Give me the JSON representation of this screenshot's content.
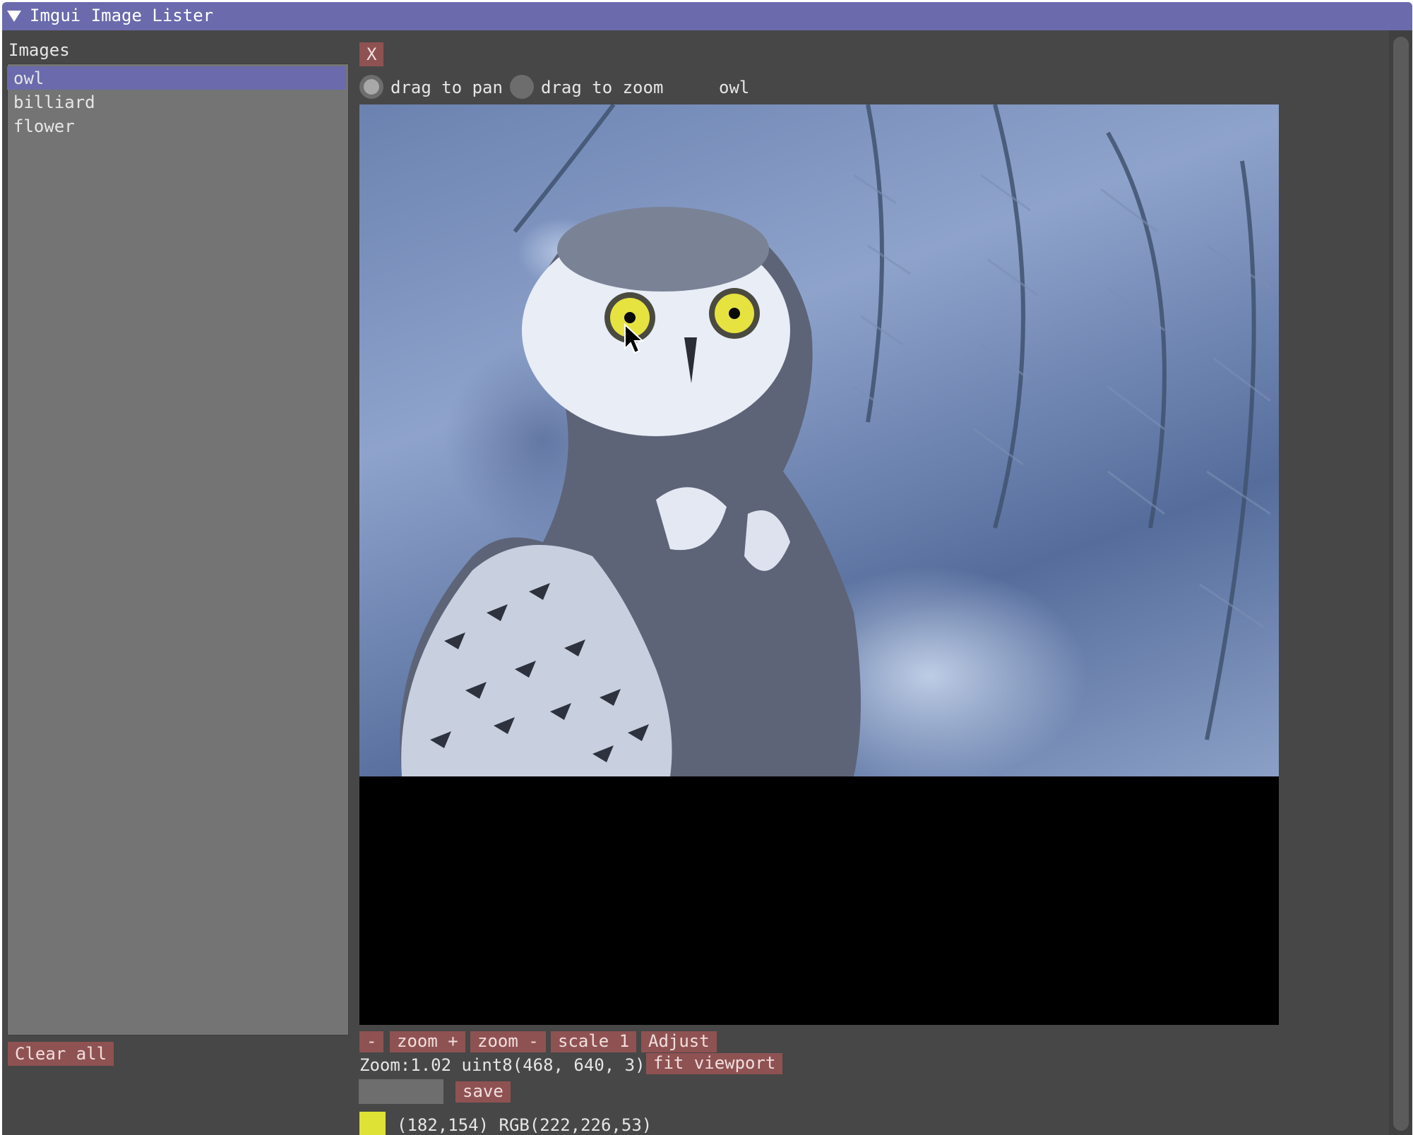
{
  "window": {
    "title": "Imgui Image Lister",
    "collapse_icon": "triangle-down-icon"
  },
  "sidebar": {
    "header": "Images",
    "items": [
      {
        "label": "owl",
        "selected": true
      },
      {
        "label": "billiard",
        "selected": false
      },
      {
        "label": "flower",
        "selected": false
      }
    ],
    "clear_all_label": "Clear all"
  },
  "viewer": {
    "close_label": "X",
    "mode_options": [
      {
        "label": "drag to pan",
        "checked": false
      },
      {
        "label": "drag to zoom",
        "checked": false
      }
    ],
    "image_name": "owl",
    "toolbar": {
      "minus_label": "-",
      "zoom_in_label": "zoom +",
      "zoom_out_label": "zoom -",
      "scale_one_label": "scale 1",
      "adjust_label": "Adjust"
    },
    "info_text": "Zoom:1.02 uint8(468, 640, 3)",
    "fit_viewport_label": "fit viewport",
    "filename_value": "",
    "save_label": "save",
    "pixel_info": "(182,154) RGB(222,226,53)",
    "pixel_color": "#dee235"
  },
  "colors": {
    "title_bar": "#6a6aad",
    "selection": "#6a6aad",
    "button": "#8f5252",
    "window_bg": "#474747",
    "list_bg": "#747474"
  }
}
